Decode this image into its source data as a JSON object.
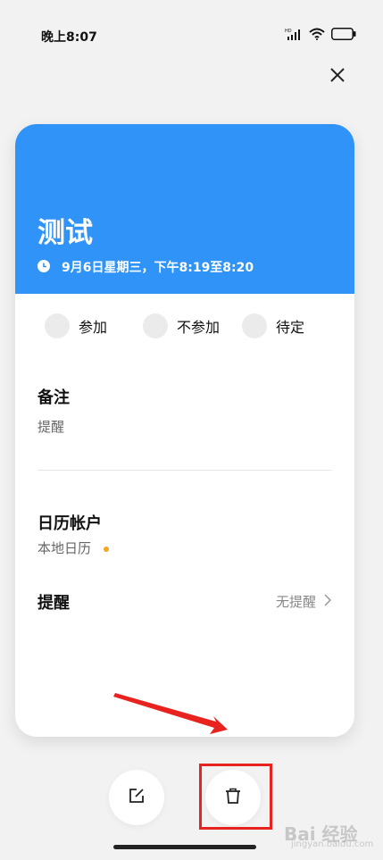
{
  "status_bar": {
    "time": "晚上8:07",
    "signal_label": "HD",
    "battery": "30"
  },
  "event": {
    "title": "测试",
    "time": "9月6日星期三，下午8:19至8:20",
    "header_color": "#2f93f7"
  },
  "rsvp": [
    {
      "label": "参加"
    },
    {
      "label": "不参加"
    },
    {
      "label": "待定"
    }
  ],
  "notes": {
    "title": "备注",
    "value": "提醒"
  },
  "calendar_account": {
    "title": "日历帐户",
    "value": "本地日历",
    "dot_color": "#f5a623"
  },
  "reminder": {
    "title": "提醒",
    "value": "无提醒"
  },
  "actions": {
    "edit_icon": "edit-icon",
    "delete_icon": "trash-icon"
  },
  "watermark": {
    "text": "Bai 经验",
    "sub": "jingyan.baidu.com"
  },
  "accent_colors": {
    "highlight": "#e8231f"
  }
}
